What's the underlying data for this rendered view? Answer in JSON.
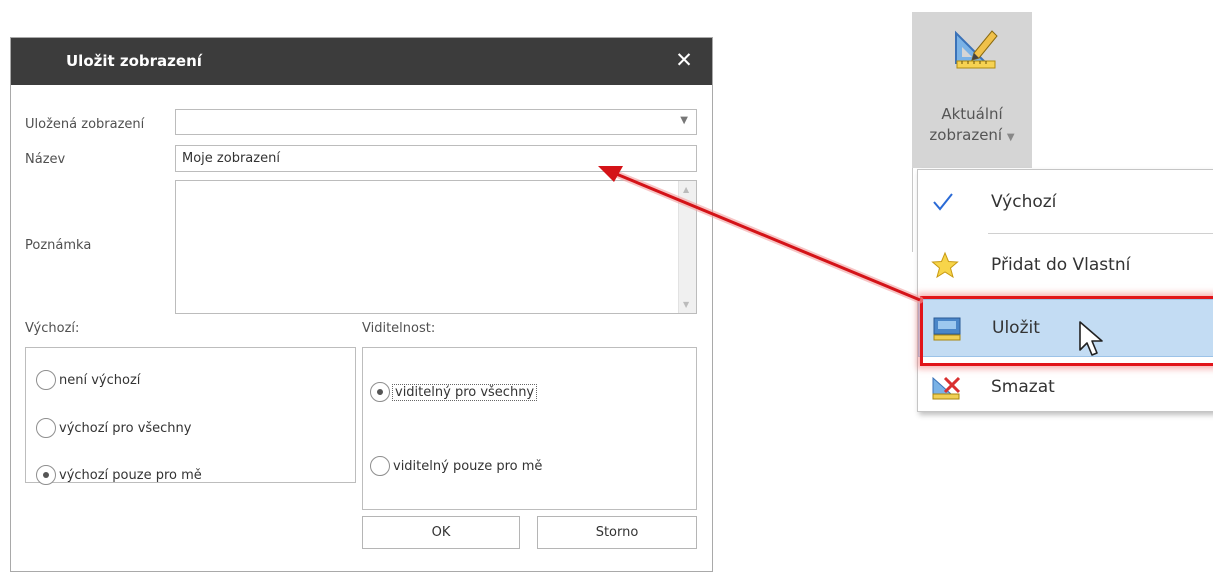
{
  "dialog": {
    "title": "Uložit zobrazení",
    "close_label": "✕",
    "saved_views_label": "Uložená zobrazení",
    "saved_views_value": "",
    "name_label": "Název",
    "name_value": "Moje zobrazení",
    "note_label": "Poznámka",
    "note_value": "",
    "default_label": "Výchozí:",
    "default_options": [
      "není výchozí",
      "výchozí pro všechny",
      "výchozí pouze pro mě"
    ],
    "default_selected": "výchozí pouze pro mě",
    "visibility_label": "Viditelnost:",
    "visibility_options": [
      "viditelný pro všechny",
      "viditelný pouze pro mě"
    ],
    "visibility_selected": "viditelný pro všechny",
    "ok_label": "OK",
    "cancel_label": "Storno"
  },
  "ribbon": {
    "button_label_line1": "Aktuální",
    "button_label_line2": "zobrazení",
    "button_icon": "ruler-pencil-icon"
  },
  "menu": {
    "items": [
      {
        "label": "Výchozí",
        "icon": "checkmark-icon"
      },
      {
        "label": "Přidat do Vlastní",
        "icon": "star-icon"
      },
      {
        "label": "Uložit",
        "icon": "save-view-icon",
        "highlighted": true
      },
      {
        "label": "Smazat",
        "icon": "delete-view-icon"
      }
    ]
  },
  "colors": {
    "titlebar": "#3c3c3c",
    "menu_highlight": "#c3dcf3",
    "annotation_red": "#e1141a",
    "ribbon_bg": "#d5d5d5"
  }
}
